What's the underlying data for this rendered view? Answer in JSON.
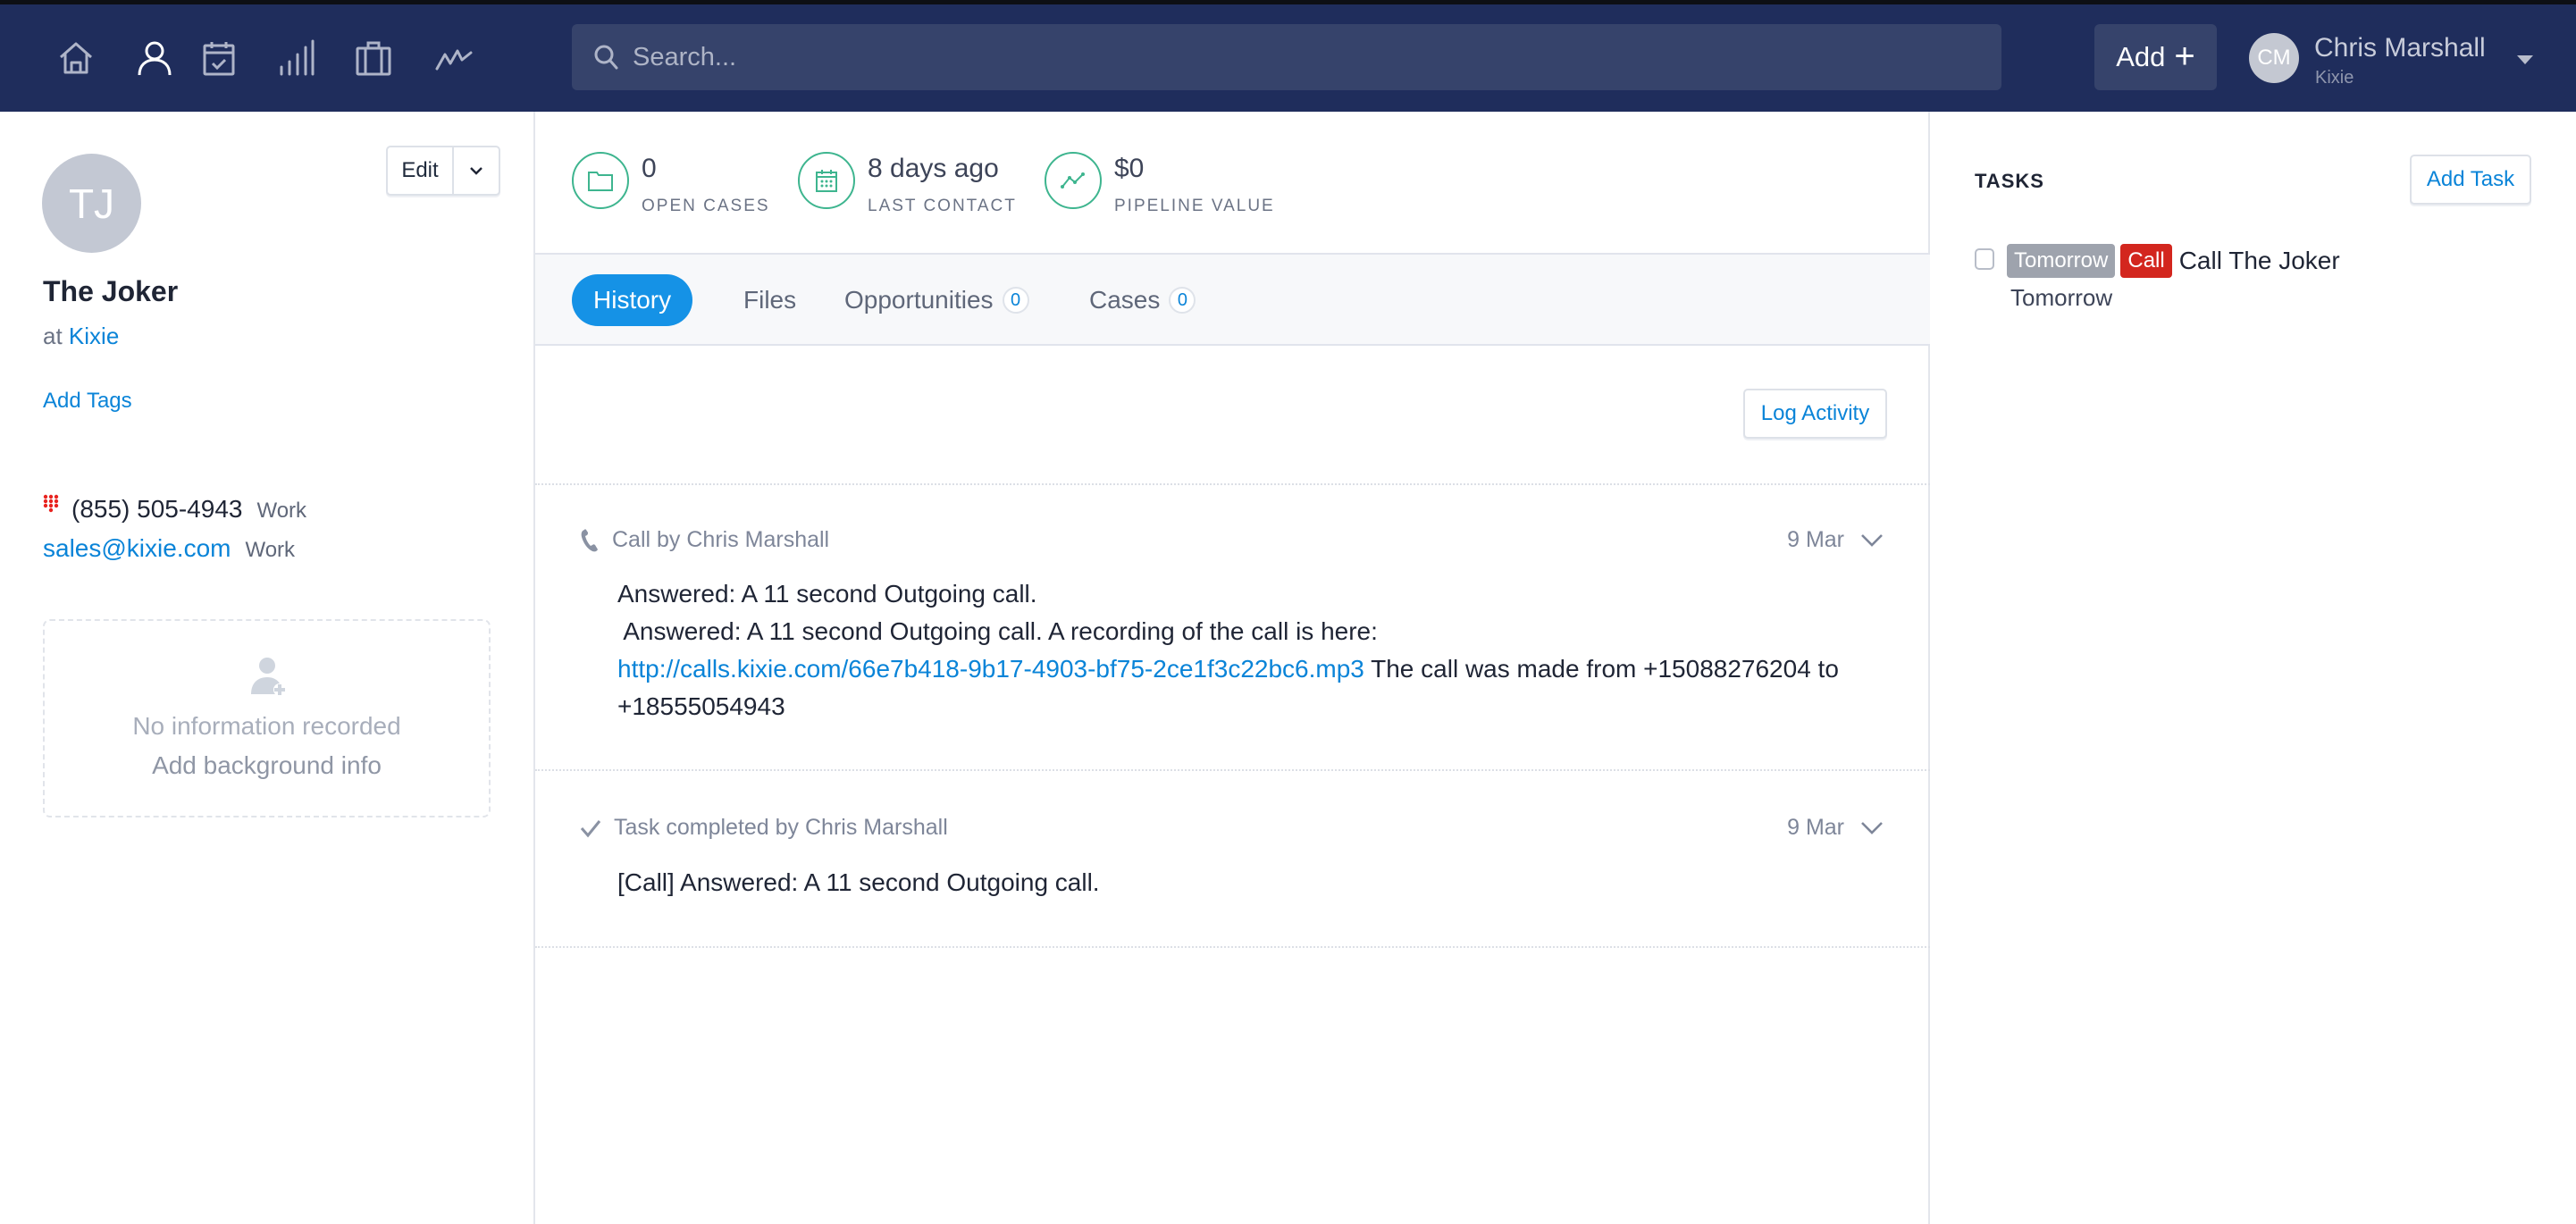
{
  "header": {
    "nav": [
      {
        "name": "home-icon",
        "label": "Home",
        "active": false
      },
      {
        "name": "person-icon",
        "label": "Contacts",
        "active": true
      },
      {
        "name": "calendar-check-icon",
        "label": "Tasks",
        "active": false
      },
      {
        "name": "signal-bars-icon",
        "label": "Reports",
        "active": false
      },
      {
        "name": "briefcase-icon",
        "label": "Cases",
        "active": false
      },
      {
        "name": "activity-line-icon",
        "label": "Pipeline",
        "active": false
      }
    ],
    "search": {
      "placeholder": "Search...",
      "value": ""
    },
    "add_label": "Add",
    "add_icon": "+",
    "user": {
      "initials": "CM",
      "name": "Chris Marshall",
      "org": "Kixie"
    }
  },
  "contact": {
    "initials": "TJ",
    "name": "The Joker",
    "at_prefix": "at",
    "company": "Kixie",
    "edit_label": "Edit",
    "add_tags_label": "Add Tags",
    "phone": {
      "number": "(855) 505-4943",
      "type": "Work"
    },
    "email": {
      "address": "sales@kixie.com",
      "type": "Work"
    },
    "background": {
      "empty_text": "No information recorded",
      "action_text": "Add background info"
    }
  },
  "stats": [
    {
      "icon": "folder-icon",
      "value": "0",
      "label": "OPEN CASES"
    },
    {
      "icon": "calendar-icon",
      "value": "8 days ago",
      "label": "LAST CONTACT"
    },
    {
      "icon": "trend-line-icon",
      "value": "$0",
      "label": "PIPELINE VALUE"
    }
  ],
  "tabs": [
    {
      "label": "History",
      "active": true
    },
    {
      "label": "Files",
      "active": false
    },
    {
      "label": "Opportunities",
      "count": "0",
      "active": false
    },
    {
      "label": "Cases",
      "count": "0",
      "active": false
    }
  ],
  "log_activity_label": "Log Activity",
  "history": [
    {
      "icon": "phone-icon",
      "title": "Call by Chris Marshall",
      "date": "9 Mar",
      "line1": "Answered: A 11 second Outgoing call.",
      "line2": " Answered: A 11 second Outgoing call. A recording of the call is here:",
      "link": "http://calls.kixie.com/66e7b418-9b17-4903-bf75-2ce1f3c22bc6.mp3",
      "line3_rest": " The call was made from +15088276204 to",
      "line4": "+18555054943"
    },
    {
      "icon": "check-icon",
      "title": "Task completed by Chris Marshall",
      "date": "9 Mar",
      "line1": "[Call] Answered: A 11 second Outgoing call."
    }
  ],
  "tasks": {
    "title": "TASKS",
    "add_label": "Add Task",
    "items": [
      {
        "when_badge": "Tomorrow",
        "type_badge": "Call",
        "title": "Call The Joker",
        "due": "Tomorrow",
        "done": false
      }
    ]
  },
  "colors": {
    "header_bg": "#1f2d5c",
    "accent_blue": "#1592e6",
    "link_blue": "#0a84d8",
    "stat_green": "#3eb58f",
    "call_red": "#d3261e"
  }
}
